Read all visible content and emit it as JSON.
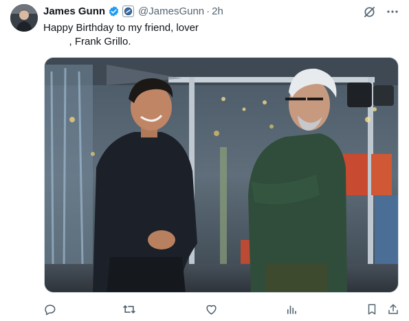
{
  "author": {
    "display_name": "James Gunn",
    "handle": "@JamesGunn",
    "separator": "·",
    "timestamp": "2h",
    "verified": true
  },
  "tweet": {
    "text": "Happy Birthday to my friend, lover\n         , Frank Grillo."
  },
  "icons": {
    "verified": "verified-badge-icon",
    "affiliate": "affiliate-badge-icon",
    "grok": "grok-icon",
    "more": "more-icon",
    "reply": "reply-icon",
    "retweet": "retweet-icon",
    "like": "like-icon",
    "views": "views-icon",
    "bookmark": "bookmark-icon",
    "share": "share-icon"
  },
  "colors": {
    "text": "#0f1419",
    "secondary": "#536471",
    "verified_blue": "#1d9bf0"
  }
}
